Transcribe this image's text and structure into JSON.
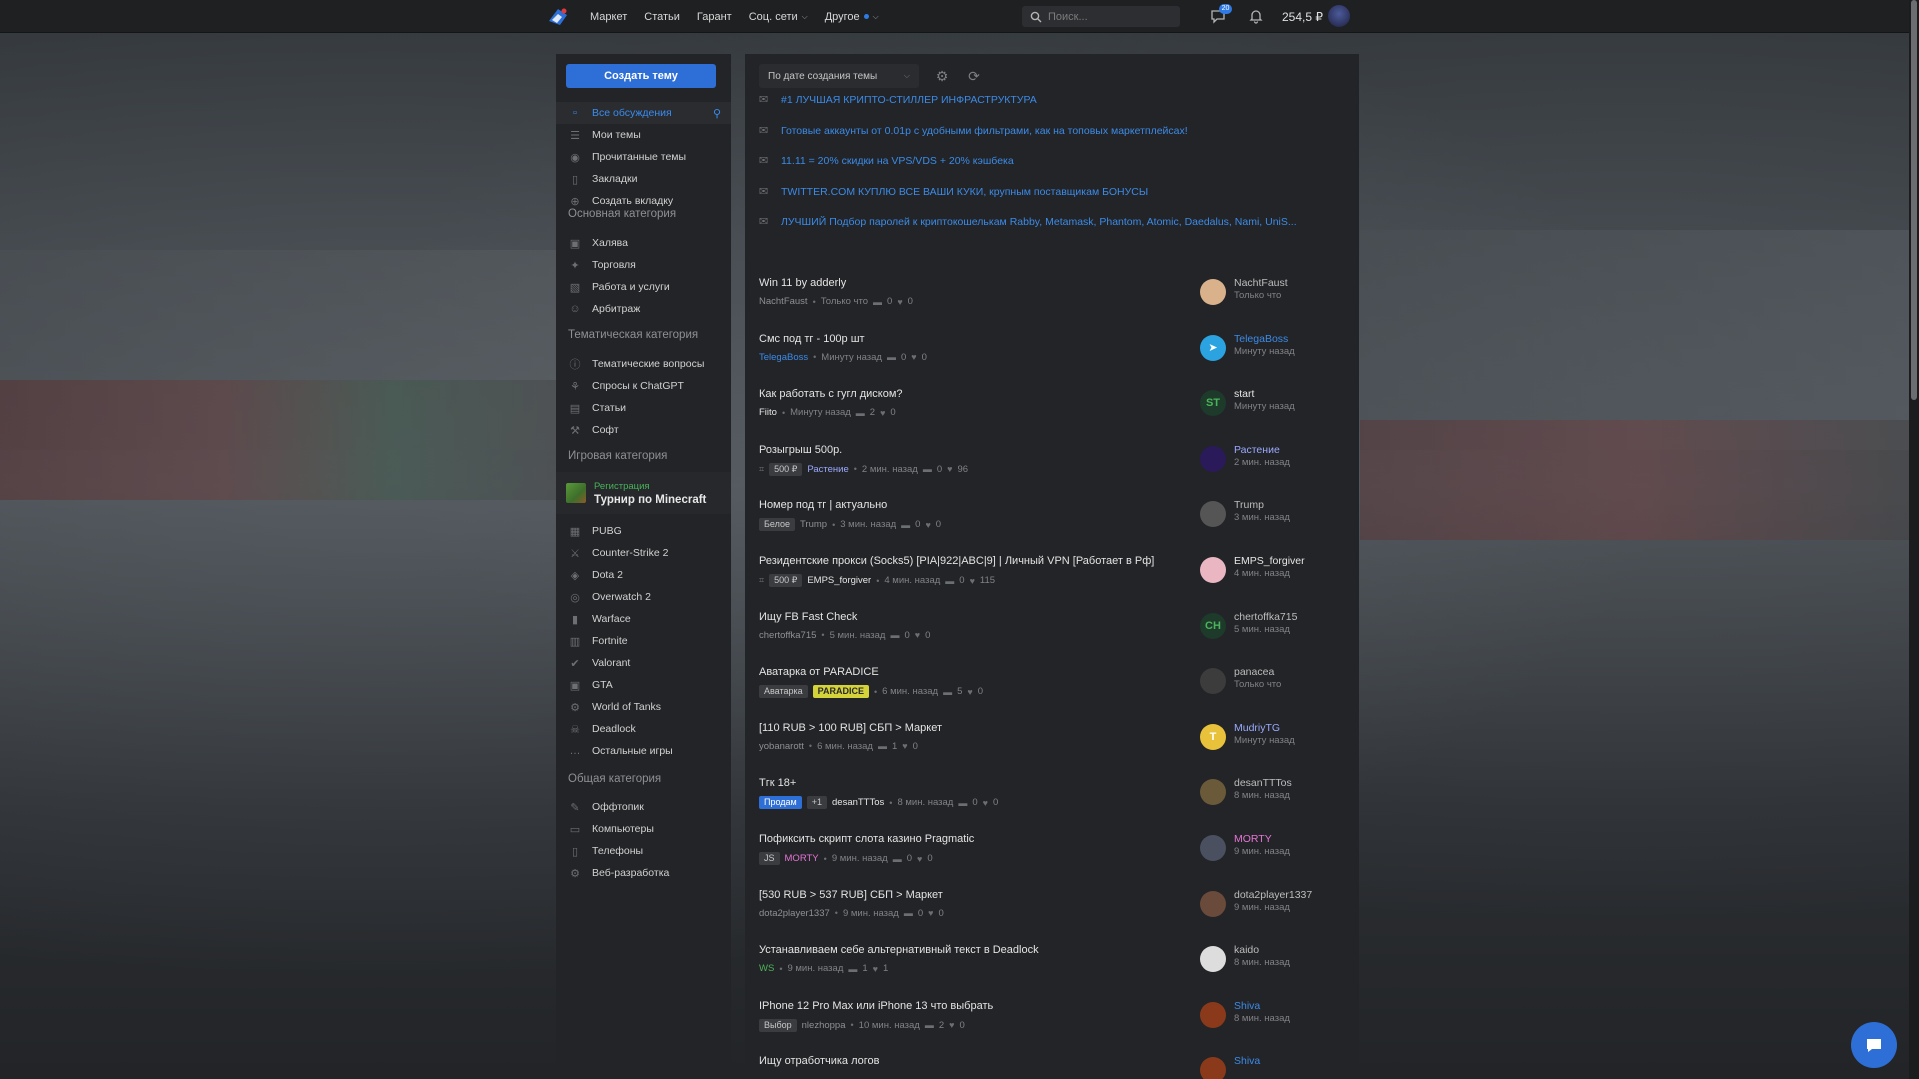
{
  "colors": {
    "accent": "#2d6fd6",
    "link": "#3b8be8",
    "panel": "#232427",
    "topbar": "#1f2022"
  },
  "nav": {
    "items": [
      {
        "label": "Маркет"
      },
      {
        "label": "Статьи"
      },
      {
        "label": "Гарант"
      },
      {
        "label": "Соц. сети"
      },
      {
        "label": "Другое"
      }
    ],
    "search_placeholder": "Поиск...",
    "messages_badge": "20",
    "balance": "254,5 ₽"
  },
  "sidebar": {
    "create_button": "Создать тему",
    "top_items": [
      {
        "label": "Все обсуждения",
        "icon": "chat-icon"
      },
      {
        "label": "Мои темы",
        "icon": "list-icon"
      },
      {
        "label": "Прочитанные темы",
        "icon": "eye-icon"
      },
      {
        "label": "Закладки",
        "icon": "bookmark-icon"
      },
      {
        "label": "Создать вкладку",
        "icon": "plus-icon"
      }
    ],
    "sections": [
      {
        "title": "Основная категория",
        "items": [
          "Халява",
          "Торговля",
          "Работа и услуги",
          "Арбитраж"
        ]
      },
      {
        "title": "Тематическая категория",
        "items": [
          "Тематические вопросы",
          "Спросы к ChatGPT",
          "Статьи",
          "Софт"
        ]
      },
      {
        "title": "Игровая категория",
        "items": [
          "PUBG",
          "Counter-Strike 2",
          "Dota 2",
          "Overwatch 2",
          "Warface",
          "Fortnite",
          "Valorant",
          "GTA",
          "World of Tanks",
          "Deadlock",
          "Остальные игры"
        ]
      },
      {
        "title": "Общая категория",
        "items": [
          "Оффтопик",
          "Компьютеры",
          "Телефоны",
          "Веб-разработка"
        ]
      }
    ],
    "promo": {
      "badge": "Регистрация",
      "title": "Турнир по Minecraft"
    }
  },
  "main": {
    "sort_label": "По дате создания темы",
    "announcements": [
      "#1 ЛУЧШАЯ КРИПТО-СТИЛЛЕР ИНФРАСТРУКТУРА",
      "Готовые аккаунты от 0.01р с удобными фильтрами, как на топовых маркетплейсах!",
      "11.11 = 20% скидки на VPS/VDS + 20% кэшбека",
      "TWITTER.COM КУПЛЮ ВСЕ ВАШИ КУКИ, крупным поставщикам БОНУСЫ",
      "ЛУЧШИЙ Подбор паролей к криптокошелькам Rabby, Metamask, Phantom, Atomic, Daedalus, Nami, UniS..."
    ],
    "threads": [
      {
        "title": "Win 11 by adderly",
        "prefix": "",
        "tags": [],
        "author": "NachtFaust",
        "author_style": "",
        "time": "Только что",
        "replies": "0",
        "likes": "0",
        "last_user": "NachtFaust",
        "last_style": "",
        "last_time": "Только что",
        "av_bg": "#d9b28c",
        "av_text": ""
      },
      {
        "title": "Смс под тг - 100р шт",
        "prefix": "",
        "tags": [],
        "author": "TelegaBoss",
        "author_style": "blue",
        "time": "Минуту назад",
        "replies": "0",
        "likes": "0",
        "last_user": "TelegaBoss",
        "last_style": "blue",
        "last_time": "Минуту назад",
        "av_bg": "#2aa3e0",
        "av_text": "➤"
      },
      {
        "title": "Как работать с гугл диском?",
        "prefix": "",
        "tags": [],
        "author": "Fiito",
        "author_style": "white",
        "time": "Минуту назад",
        "replies": "2",
        "likes": "0",
        "last_user": "start",
        "last_style": "white",
        "last_time": "Минуту назад",
        "av_bg": "#1d3a2a",
        "av_text": "ST"
      },
      {
        "title": "Розыгрыш 500р.",
        "prefix": "🎁",
        "tags": [
          {
            "t": "500 ₽",
            "s": "prize"
          }
        ],
        "author": "Растение",
        "author_style": "purple",
        "time": "2 мин. назад",
        "replies": "0",
        "likes": "96",
        "last_user": "Растение",
        "last_style": "purple",
        "last_time": "2 мин. назад",
        "av_bg": "#2a1a5a",
        "av_text": ""
      },
      {
        "title": "Номер под тг | актуально",
        "prefix": "",
        "tags": [
          {
            "t": "Белое",
            "s": ""
          }
        ],
        "author": "Trump",
        "author_style": "",
        "time": "3 мин. назад",
        "replies": "0",
        "likes": "0",
        "last_user": "Trump",
        "last_style": "",
        "last_time": "3 мин. назад",
        "av_bg": "#555555",
        "av_text": ""
      },
      {
        "title": "Резидентские прокси (Socks5) [PIA|922|ABC|9] | Личный VPN [Работает в Рф]",
        "prefix": "🎁",
        "tags": [
          {
            "t": "500 ₽",
            "s": "prize"
          }
        ],
        "author": "EMPS_forgiver",
        "author_style": "white",
        "time": "4 мин. назад",
        "replies": "0",
        "likes": "115",
        "last_user": "EMPS_forgiver",
        "last_style": "white",
        "last_time": "4 мин. назад",
        "av_bg": "#e9b6c2",
        "av_text": ""
      },
      {
        "title": "Ищу FB Fast Check",
        "prefix": "",
        "tags": [],
        "author": "chertoffka715",
        "author_style": "",
        "time": "5 мин. назад",
        "replies": "0",
        "likes": "0",
        "last_user": "chertoffka715",
        "last_style": "",
        "last_time": "5 мин. назад",
        "av_bg": "#1d3a2a",
        "av_text": "CH"
      },
      {
        "title": "Аватарка от PARADICE",
        "prefix": "",
        "tags": [
          {
            "t": "Аватарка",
            "s": ""
          },
          {
            "t": "PARADICE",
            "s": "yellow"
          }
        ],
        "author": "",
        "author_style": "",
        "time": "6 мин. назад",
        "replies": "5",
        "likes": "0",
        "last_user": "panacea",
        "last_style": "",
        "last_time": "Только что",
        "av_bg": "#3c3c3c",
        "av_text": ""
      },
      {
        "title": "[110 RUB > 100 RUB] СБП > Маркет",
        "prefix": "",
        "tags": [],
        "author": "yobanarott",
        "author_style": "",
        "time": "6 мин. назад",
        "replies": "1",
        "likes": "0",
        "last_user": "MudriyTG",
        "last_style": "purple",
        "last_time": "Минуту назад",
        "av_bg": "#e8c23a",
        "av_text": "T"
      },
      {
        "title": "Тгк 18+",
        "prefix": "",
        "tags": [
          {
            "t": "Продам",
            "s": "blue"
          },
          {
            "t": "+1",
            "s": ""
          }
        ],
        "author": "desanTTTos",
        "author_style": "white",
        "time": "8 мин. назад",
        "replies": "0",
        "likes": "0",
        "last_user": "desanTTTos",
        "last_style": "",
        "last_time": "8 мин. назад",
        "av_bg": "#6a5a3a",
        "av_text": ""
      },
      {
        "title": "Пофиксить скрипт слота казино Pragmatic",
        "prefix": "",
        "tags": [
          {
            "t": "JS",
            "s": ""
          }
        ],
        "author": "MORTY",
        "author_style": "pink",
        "time": "9 мин. назад",
        "replies": "0",
        "likes": "0",
        "last_user": "MORTY",
        "last_style": "pink",
        "last_time": "9 мин. назад",
        "av_bg": "#4a5060",
        "av_text": ""
      },
      {
        "title": "[530 RUB > 537 RUB] СБП > Маркет",
        "prefix": "",
        "tags": [],
        "author": "dota2player1337",
        "author_style": "",
        "time": "9 мин. назад",
        "replies": "0",
        "likes": "0",
        "last_user": "dota2player1337",
        "last_style": "",
        "last_time": "9 мин. назад",
        "av_bg": "#6a4a3a",
        "av_text": ""
      },
      {
        "title": "Устанавливаем себе альтернативный текст в Deadlock",
        "prefix": "",
        "tags": [],
        "author": "WS",
        "author_style": "green",
        "time": "9 мин. назад",
        "replies": "1",
        "likes": "1",
        "last_user": "kaido",
        "last_style": "",
        "last_time": "8 мин. назад",
        "av_bg": "#dddddd",
        "av_text": ""
      },
      {
        "title": "IPhone 12 Pro Max или iPhone 13 что выбрать",
        "prefix": "",
        "tags": [
          {
            "t": "Выбор",
            "s": ""
          }
        ],
        "author": "nlezhoppa",
        "author_style": "",
        "time": "10 мин. назад",
        "replies": "2",
        "likes": "0",
        "last_user": "Shiva",
        "last_style": "blue",
        "last_time": "8 мин. назад",
        "av_bg": "#8a3a1a",
        "av_text": ""
      },
      {
        "title": "Ищу отработчика логов",
        "prefix": "",
        "tags": [],
        "author": "",
        "author_style": "",
        "time": "",
        "replies": "",
        "likes": "",
        "last_user": "Shiva",
        "last_style": "blue",
        "last_time": "",
        "av_bg": "#8a3a1a",
        "av_text": ""
      }
    ]
  }
}
